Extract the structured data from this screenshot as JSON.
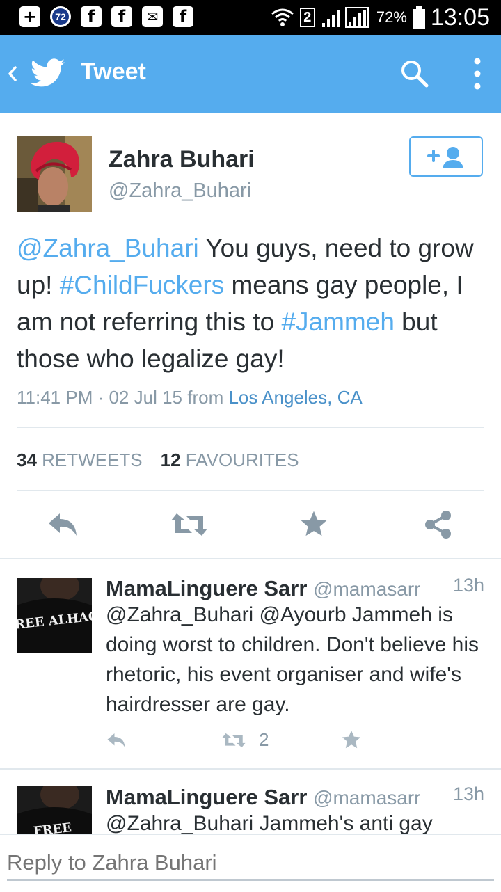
{
  "status_bar": {
    "notif_count": "72",
    "sim_label": "2",
    "battery": "72%",
    "time": "13:05",
    "icons": [
      "add-icon",
      "notification-count-icon",
      "facebook-icon",
      "facebook-icon",
      "mail-icon",
      "facebook-icon",
      "wifi-icon",
      "signal-icon",
      "battery-icon"
    ]
  },
  "toolbar": {
    "title": "Tweet",
    "icons": [
      "back-chevron-icon",
      "twitter-bird-icon",
      "search-icon",
      "overflow-menu-icon"
    ],
    "background": "#55acee"
  },
  "author": {
    "name": "Zahra Buhari",
    "handle": "@Zahra_Buhari"
  },
  "tweet": {
    "parts": [
      {
        "text": "@Zahra_Buhari",
        "link": true
      },
      {
        "text": " You guys, need to grow up! ",
        "link": false
      },
      {
        "text": "#ChildFuckers",
        "link": true
      },
      {
        "text": " means gay people, I am not referring this to ",
        "link": false
      },
      {
        "text": "#Jammeh",
        "link": true
      },
      {
        "text": " but those who legalize gay!",
        "link": false
      }
    ],
    "time": "11:41 PM · 02 Jul 15",
    "from_label": "from",
    "place": "Los Angeles, CA"
  },
  "stats": {
    "retweets_count": "34",
    "retweets_label": "RETWEETS",
    "favourites_count": "12",
    "favourites_label": "FAVOURITES"
  },
  "replies": [
    {
      "name": "MamaLinguere Sarr",
      "handle": "@mamasarr",
      "time": "13h",
      "text": "@Zahra_Buhari @Ayourb Jammeh is doing worst to children. Don't believe his rhetoric, his event organiser and wife's hairdresser are gay.",
      "retweet_count": "2",
      "avatar_text": "FREE ALHAG"
    },
    {
      "name": "MamaLinguere Sarr",
      "handle": "@mamasarr",
      "time": "13h",
      "text": "@Zahra_Buhari Jammeh's anti gay",
      "avatar_text": "FREE"
    }
  ],
  "reply_bar": {
    "placeholder": "Reply to Zahra Buhari"
  },
  "colors": {
    "accent": "#55acee",
    "text": "#292f33",
    "muted": "#8899a6"
  }
}
